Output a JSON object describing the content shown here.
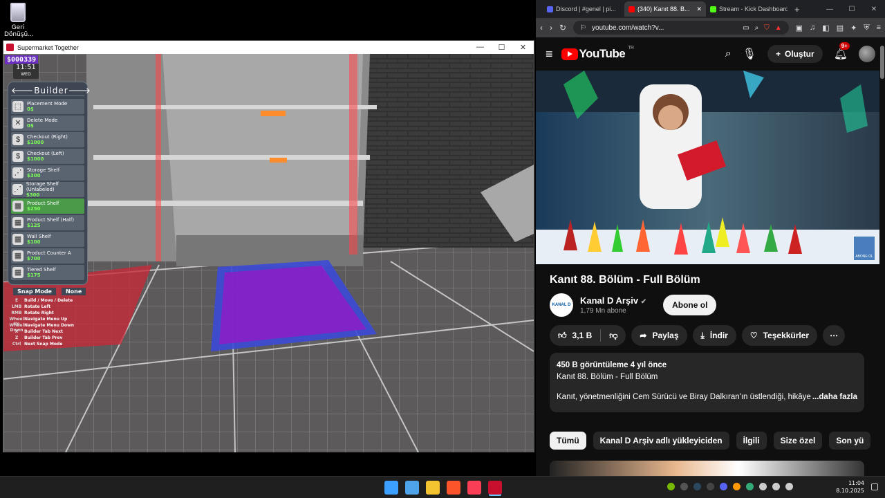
{
  "desktop": {
    "recycle_label": "Geri Dönüşü..."
  },
  "game_window": {
    "title": "Supermarket Together",
    "controls": [
      "—",
      "☐",
      "✕"
    ],
    "hud": {
      "money": "$000339",
      "time": "11:51",
      "day": "WED"
    },
    "builder": {
      "title": "Builder",
      "items": [
        {
          "name": "Placement Mode",
          "price": "0$"
        },
        {
          "name": "Delete Mode",
          "price": "0$"
        },
        {
          "name": "Checkout (Right)",
          "price": "$1000"
        },
        {
          "name": "Checkout (Left)",
          "price": "$1000"
        },
        {
          "name": "Storage Shelf",
          "price": "$300"
        },
        {
          "name": "Storage Shelf (Unlabeled)",
          "price": "$300"
        },
        {
          "name": "Product Shelf",
          "price": "$250"
        },
        {
          "name": "Product Shelf (Half)",
          "price": "$125"
        },
        {
          "name": "Wall Shelf",
          "price": "$100"
        },
        {
          "name": "Product Counter A",
          "price": "$700"
        },
        {
          "name": "Tiered Shelf",
          "price": "$175"
        }
      ],
      "snap_label": "Snap Mode",
      "snap_value": "None"
    },
    "keys": [
      {
        "key": "E",
        "action": "Build / Move / Delete"
      },
      {
        "key": "LMB",
        "action": "Rotate Left"
      },
      {
        "key": "RMB",
        "action": "Rotate Right"
      },
      {
        "key": "Wheel Up",
        "action": "Navigate Menu Up"
      },
      {
        "key": "Wheel Down",
        "action": "Navigate Menu Down"
      },
      {
        "key": "X",
        "action": "Builder Tab Next"
      },
      {
        "key": "Z",
        "action": "Builder Tab Prev"
      },
      {
        "key": "Ctrl",
        "action": "Next Snap Mode"
      }
    ]
  },
  "browser": {
    "tabs": [
      {
        "label": "Discord | #genel | pi...",
        "color": "#5865f2",
        "active": false
      },
      {
        "label": "(340) Kanıt 88. B...",
        "color": "#ff0000",
        "active": true
      },
      {
        "label": "Stream - Kick Dashboard",
        "color": "#53fc18",
        "active": false
      }
    ],
    "url": "youtube.com/watch?v...",
    "youtube": {
      "logo_text": "YouTube",
      "country": "TR",
      "create_label": "Oluştur",
      "notif_count": "9+",
      "video_title": "Kanıt 88. Bölüm - Full Bölüm",
      "channel_name": "Kanal D Arşiv",
      "channel_subs": "1,79 Mn abone",
      "channel_logo_text": "KANAL D",
      "subscribe_label": "Abone ol",
      "likes": "3,1 B",
      "share_label": "Paylaş",
      "download_label": "İndir",
      "thanks_label": "Teşekkürler",
      "more_label": "⋯",
      "desc_meta": "450 B görüntüleme  4 yıl önce",
      "desc_line2": "Kanıt 88. Bölüm - Full Bölüm",
      "desc_body": "Kanıt, yönetmenliğini Cem Sürücü ve Biray Dalkıran'ın üstlendiği, hikâyel",
      "desc_more": "...daha fazla",
      "chips": [
        "Tümü",
        "Kanal D Arşiv adlı yükleyiciden",
        "İlgili",
        "Size özel",
        "Son yü"
      ],
      "watermark": "ABONE OL"
    }
  },
  "taskbar": {
    "time": "11:04",
    "date": "8.10.2025",
    "apps": [
      {
        "name": "start",
        "color": "#3ba0ff"
      },
      {
        "name": "gallery",
        "color": "#4fa3e8"
      },
      {
        "name": "explorer",
        "color": "#f4c430"
      },
      {
        "name": "brave",
        "color": "#fb542b"
      },
      {
        "name": "music",
        "color": "#fa3e55"
      },
      {
        "name": "supermarket",
        "color": "#c8102e"
      }
    ]
  }
}
